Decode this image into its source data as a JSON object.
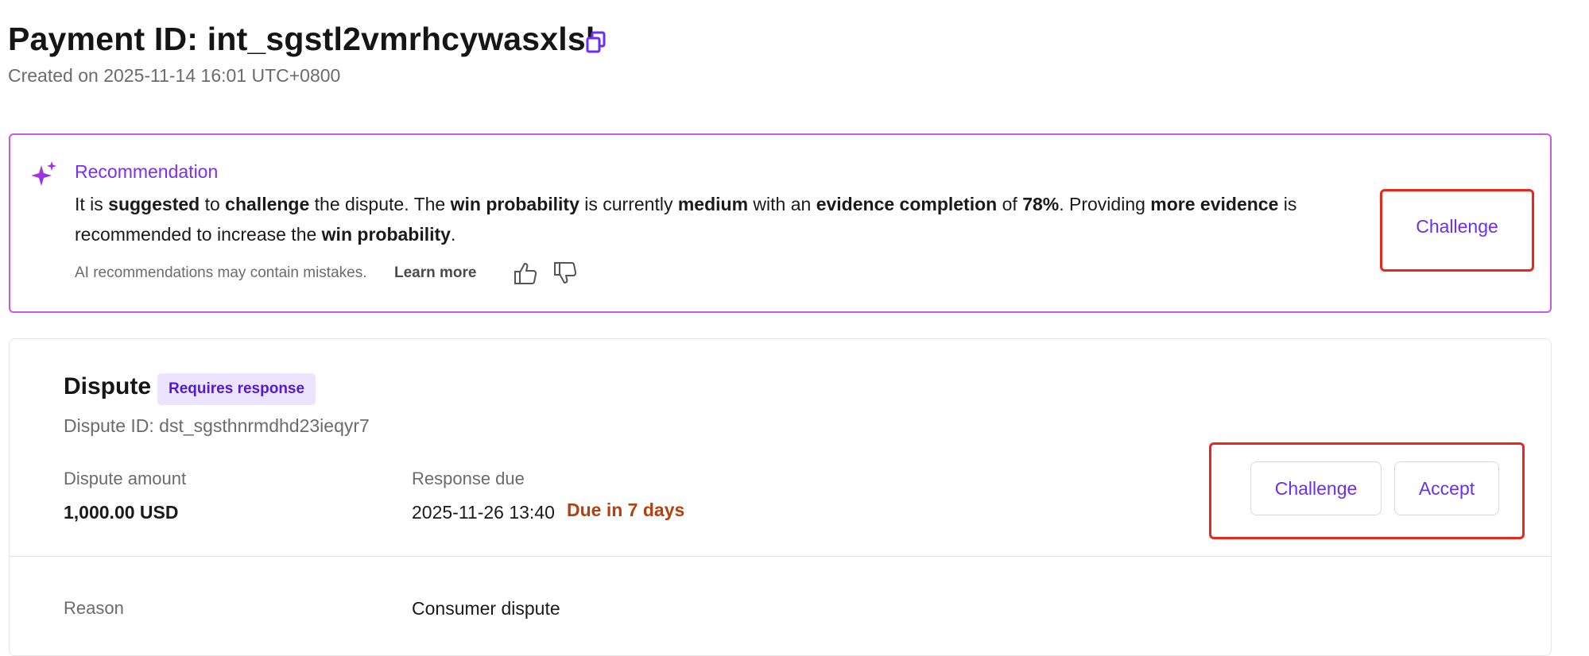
{
  "header": {
    "title": "Payment ID: int_sgstl2vmrhcywasxlsl",
    "created": "Created on 2025-11-14 16:01 UTC+0800",
    "copy_icon": "copy-icon"
  },
  "recommendation": {
    "title": "Recommendation",
    "body": [
      {
        "t": "It is ",
        "b": false
      },
      {
        "t": "suggested",
        "b": true
      },
      {
        "t": " to ",
        "b": false
      },
      {
        "t": "challenge",
        "b": true
      },
      {
        "t": " the dispute. The ",
        "b": false
      },
      {
        "t": "win probability",
        "b": true
      },
      {
        "t": " is currently ",
        "b": false
      },
      {
        "t": "medium",
        "b": true
      },
      {
        "t": " with an ",
        "b": false
      },
      {
        "t": "evidence completion",
        "b": true
      },
      {
        "t": " of ",
        "b": false
      },
      {
        "t": "78%",
        "b": true
      },
      {
        "t": ". Providing ",
        "b": false
      },
      {
        "t": "more evidence",
        "b": true
      },
      {
        "t": " is recommended to increase the ",
        "b": false
      },
      {
        "t": "win probability",
        "b": true
      },
      {
        "t": ".",
        "b": false
      }
    ],
    "disclaimer": "AI recommendations may contain mistakes.",
    "learn_more": "Learn more",
    "challenge_label": "Challenge",
    "accent_color": "#7b2ff0",
    "border_color": "#c65ae8"
  },
  "dispute": {
    "title": "Dispute",
    "badge": "Requires response",
    "id_text": "Dispute ID: dst_sgsthnrmdhd23ieqyr7",
    "amount_label": "Dispute amount",
    "amount_value": "1,000.00 USD",
    "due_label": "Response due",
    "due_value": "2025-11-26 13:40",
    "due_note": "Due in 7 days",
    "reason_label": "Reason",
    "reason_value": "Consumer dispute",
    "challenge_label": "Challenge",
    "accept_label": "Accept",
    "due_color": "#b4400f",
    "highlight_color": "#e8281b"
  }
}
